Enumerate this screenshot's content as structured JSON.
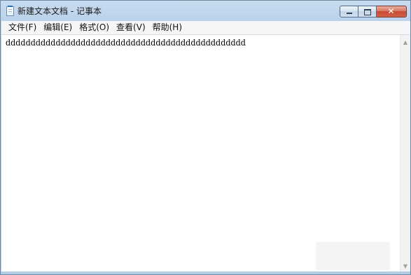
{
  "window": {
    "title": "新建文本文档 - 记事本",
    "icon": "notepad-icon"
  },
  "caption": {
    "minimize_glyph": "—",
    "maximize_glyph": "□",
    "close_glyph": "✕"
  },
  "menu": {
    "items": [
      {
        "label": "文件(F)"
      },
      {
        "label": "编辑(E)"
      },
      {
        "label": "格式(O)"
      },
      {
        "label": "查看(V)"
      },
      {
        "label": "帮助(H)"
      }
    ]
  },
  "editor": {
    "content": "dddddddddddddddddddddddddddddddddddddddddddddddd"
  },
  "scrollbar": {
    "up_arrow": "▲",
    "down_arrow": "▼"
  }
}
